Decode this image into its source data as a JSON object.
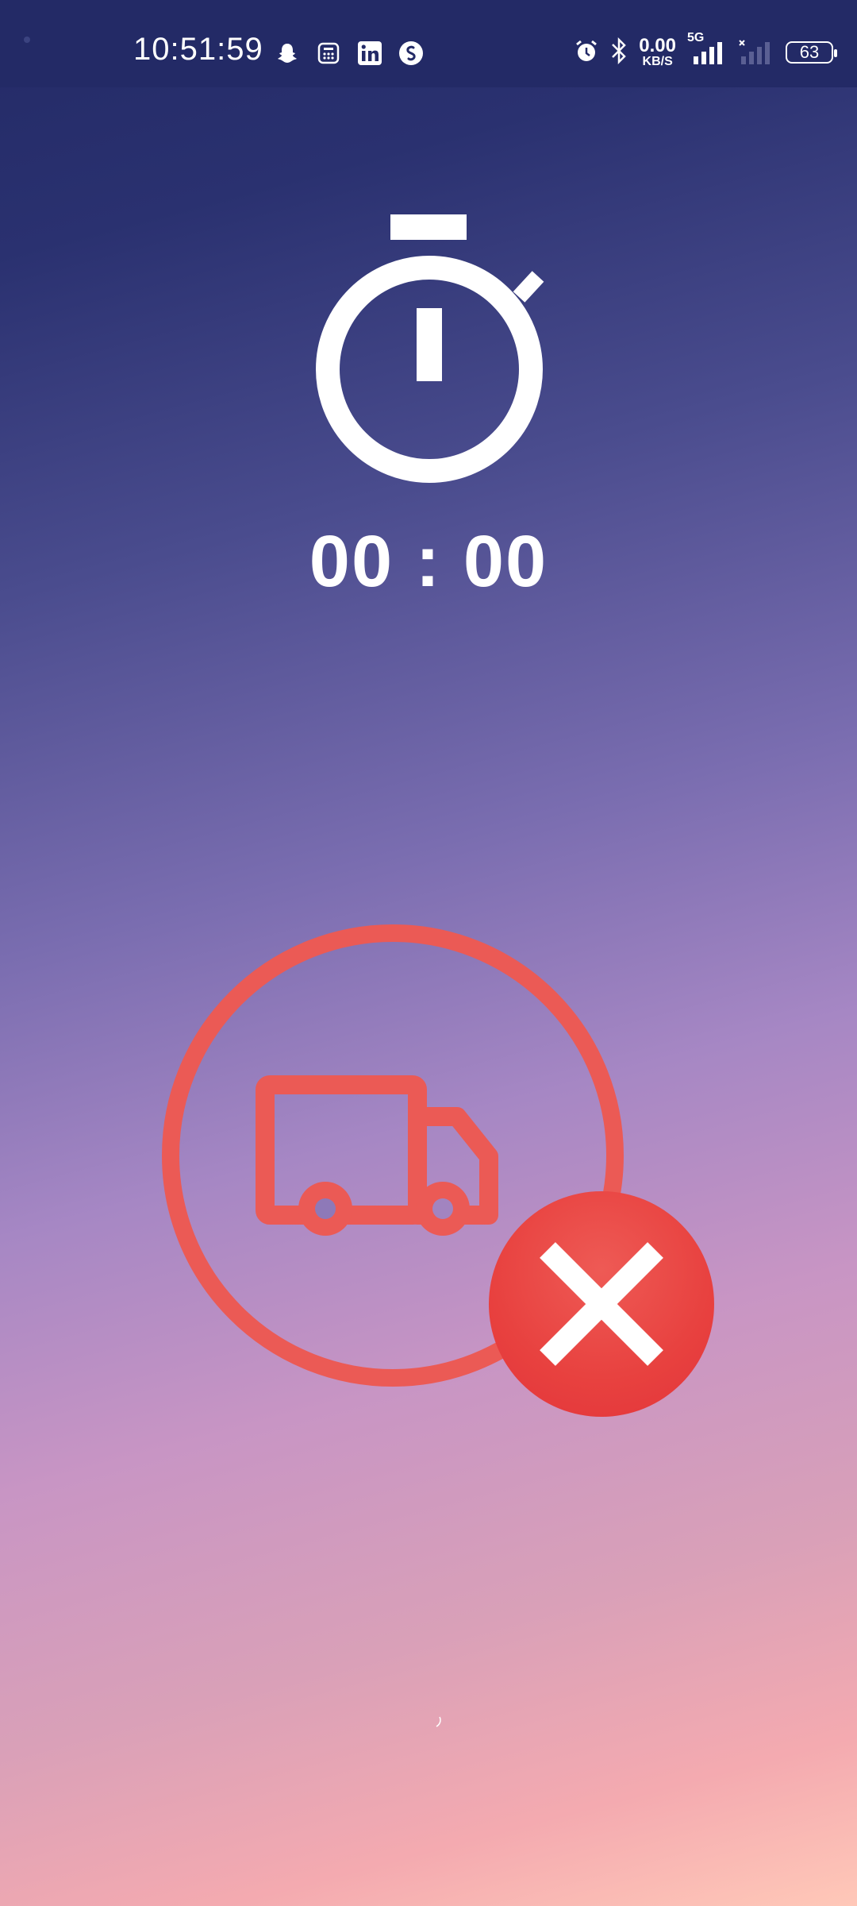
{
  "status_bar": {
    "time": "10:51:59",
    "net_speed_value": "0.00",
    "net_speed_unit": "KB/S",
    "network_type": "5G",
    "battery_level": "63",
    "notification_icons": [
      "snapchat-icon",
      "calculator-icon",
      "linkedin-icon",
      "shazam-icon"
    ],
    "status_icons": [
      "alarm-icon",
      "bluetooth-icon",
      "signal-icon",
      "signal-icon-secondary",
      "battery-icon"
    ]
  },
  "stopwatch": {
    "icon": "stopwatch-icon",
    "elapsed": "00 : 00"
  },
  "delivery": {
    "icon": "truck-icon",
    "status_icon": "close-icon"
  },
  "colors": {
    "accent_red": "#EB5A55",
    "cancel_red": "#E8413F",
    "text_white": "#FFFFFF",
    "status_bar_bg": "#232A66"
  }
}
